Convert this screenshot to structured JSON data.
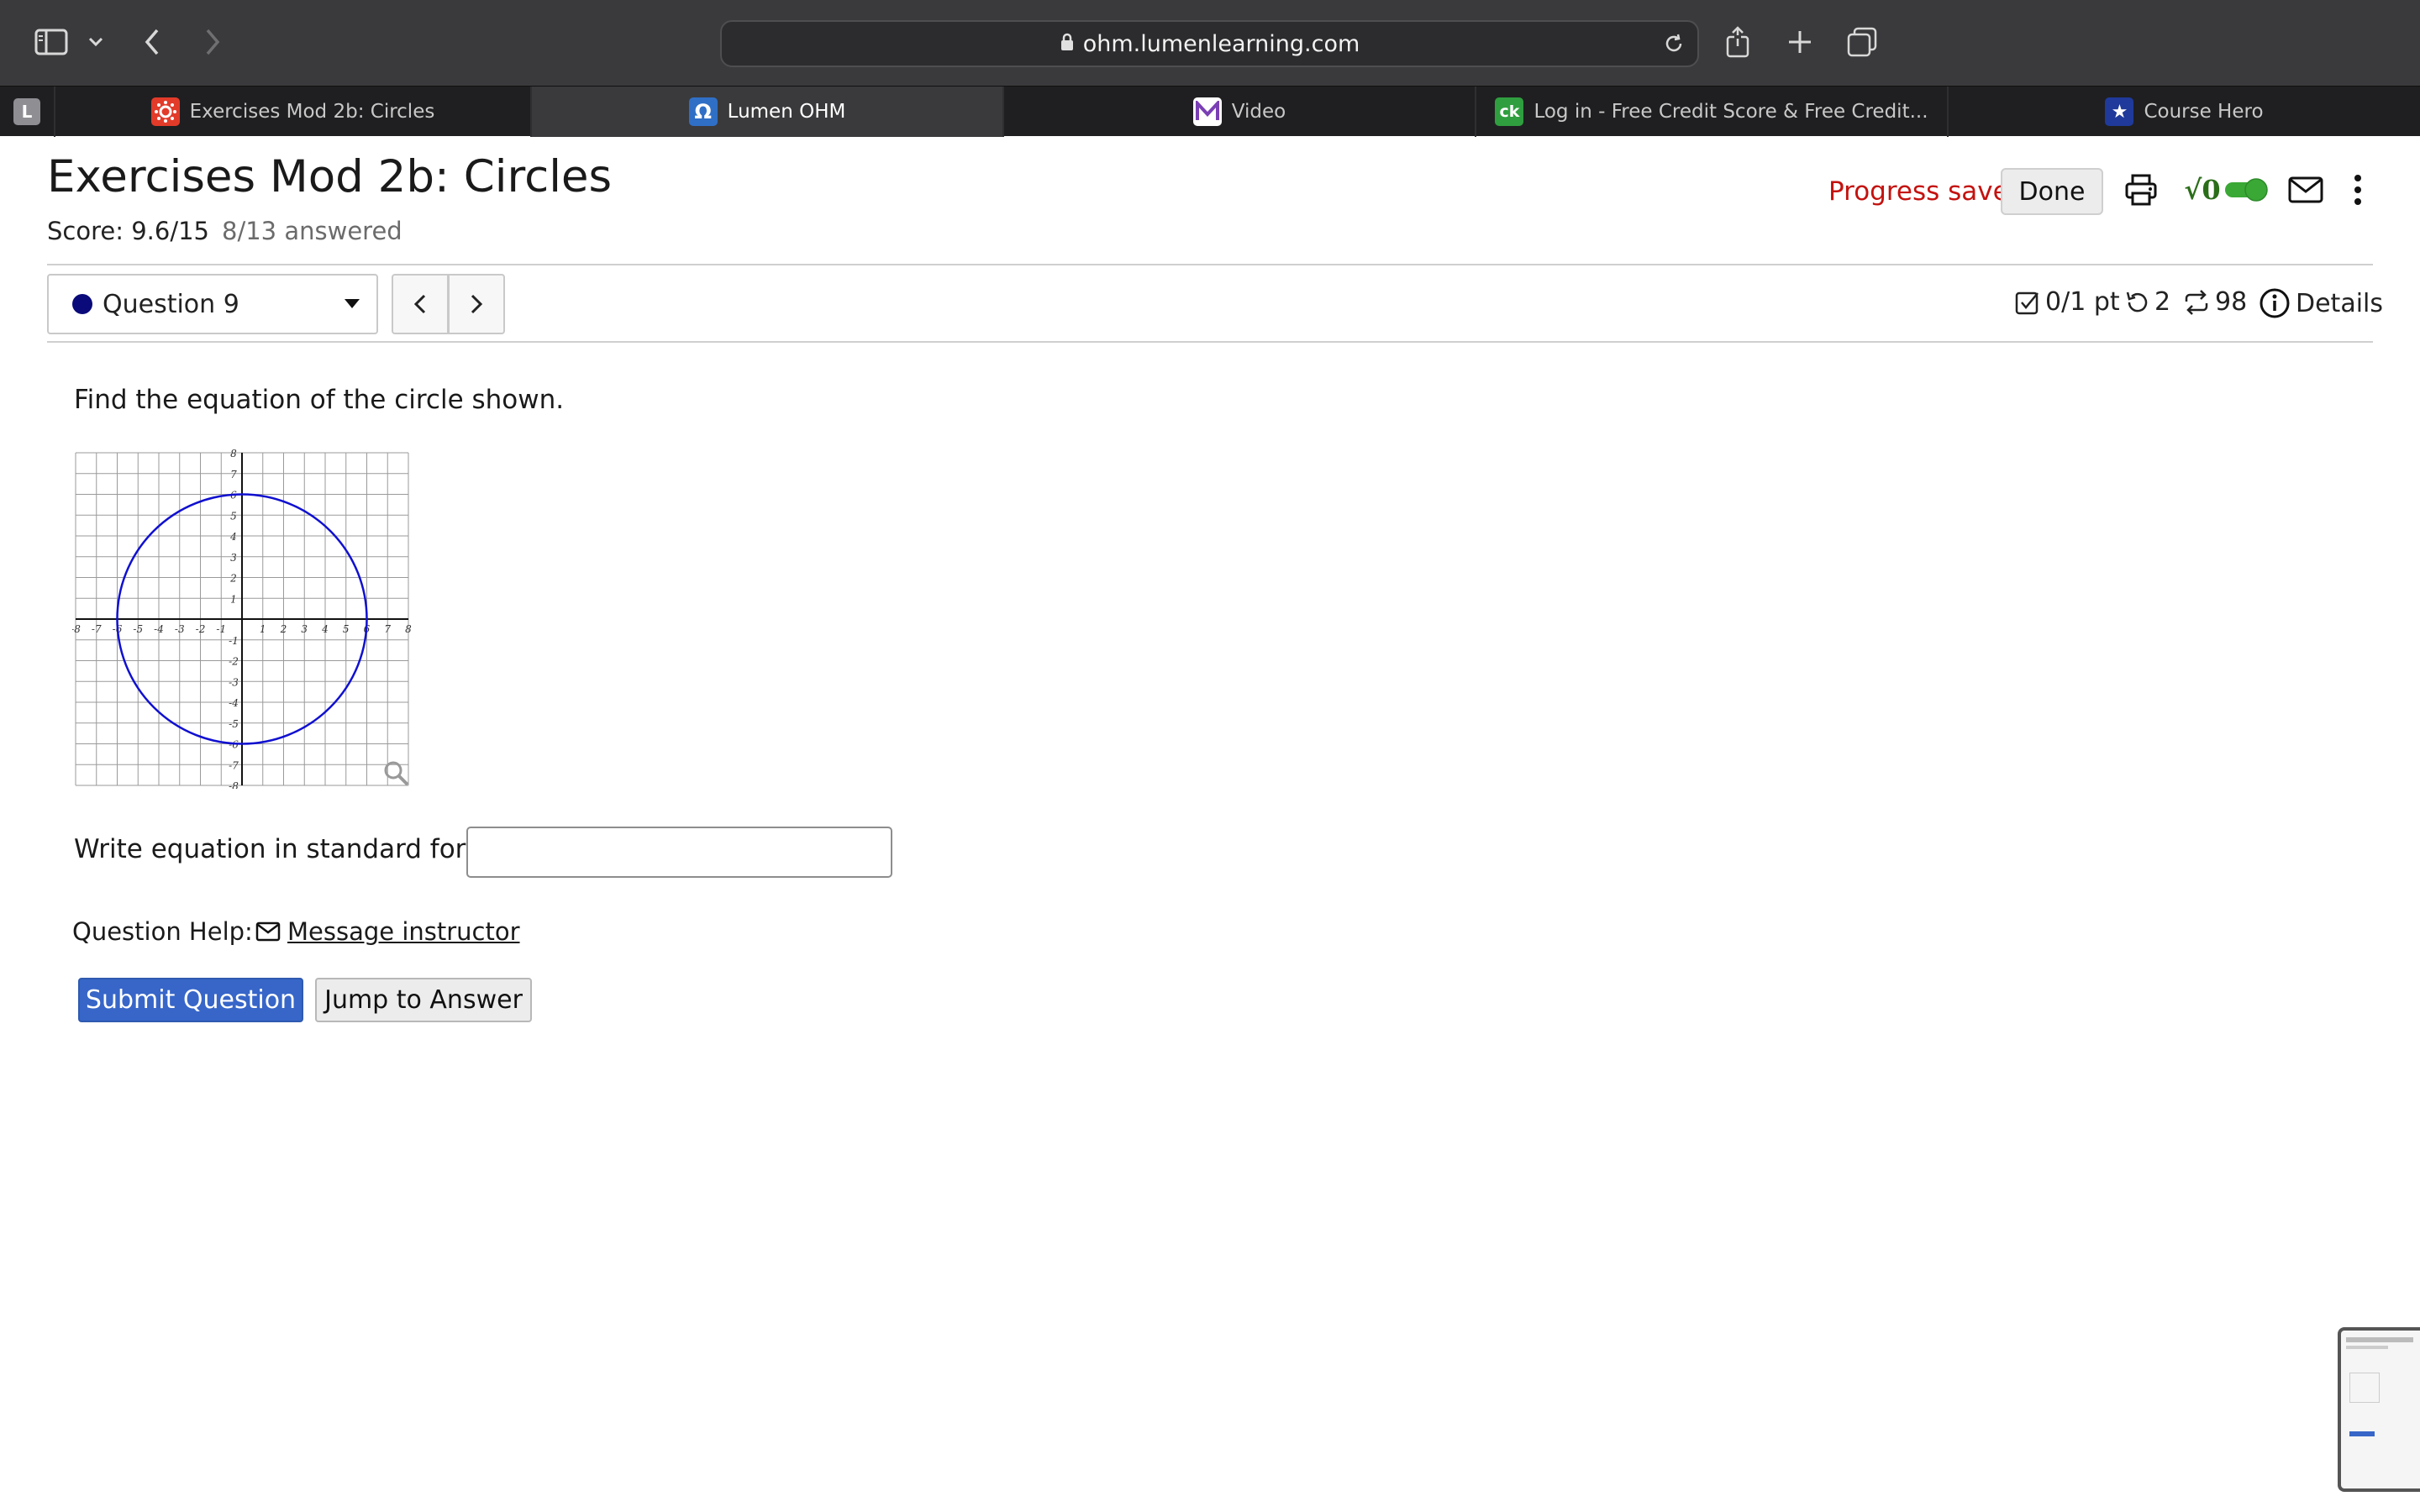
{
  "browser": {
    "url": "ohm.lumenlearning.com",
    "tabs": [
      {
        "label": "L",
        "favicon": "profile-l-icon",
        "active": false
      },
      {
        "label": "Exercises Mod 2b: Circles",
        "favicon": "canvas-icon",
        "active": false
      },
      {
        "label": "Lumen OHM",
        "favicon": "omega-icon",
        "active": true
      },
      {
        "label": "Video",
        "favicon": "m-icon",
        "active": false
      },
      {
        "label": "Log in - Free Credit Score & Free Credit...",
        "favicon": "ck-icon",
        "active": false
      },
      {
        "label": "Course Hero",
        "favicon": "star-shield-icon",
        "active": false
      }
    ]
  },
  "header": {
    "title": "Exercises Mod 2b: Circles",
    "score": "Score: 9.6/15",
    "answered": "8/13 answered",
    "progress_status": "Progress saved",
    "done_label": "Done",
    "math_toggle_label": "√0",
    "math_toggle_on": true
  },
  "question_nav": {
    "selected": "Question 9",
    "points": "0/1 pt",
    "retries": "2",
    "attempts": "98",
    "details_label": "Details"
  },
  "question": {
    "prompt": "Find the equation of the circle shown.",
    "answer_label": "Write equation in standard form:",
    "answer_value": "",
    "help_label": "Question Help:",
    "message_link": "Message instructor"
  },
  "graph": {
    "x_range": [
      -8,
      8
    ],
    "y_range": [
      -8,
      8
    ],
    "x_ticks": [
      "-8",
      "-7",
      "-6",
      "-5",
      "-4",
      "-3",
      "-2",
      "-1",
      "1",
      "2",
      "3",
      "4",
      "5",
      "6",
      "7",
      "8"
    ],
    "y_ticks": [
      "8",
      "7",
      "6",
      "5",
      "4",
      "3",
      "2",
      "1",
      "-1",
      "-2",
      "-3",
      "-4",
      "-5",
      "-6",
      "-7",
      "-8"
    ],
    "circle": {
      "center_x": 0,
      "center_y": 0,
      "radius": 6
    },
    "circle_color": "#1010d0"
  },
  "actions": {
    "submit_label": "Submit Question",
    "jump_label": "Jump to Answer"
  },
  "colors": {
    "progress_saved": "#c3120f",
    "submit_bg": "#3766c8",
    "toggle_on": "#3aa835"
  }
}
